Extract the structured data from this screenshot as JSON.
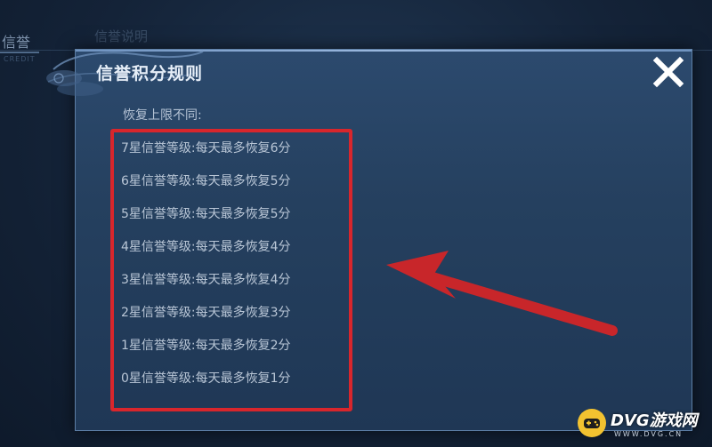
{
  "background": {
    "tab_label": "信誉",
    "tab_sublabel": "CREDIT",
    "tab2_label": "信誉说明"
  },
  "modal": {
    "title": "信誉积分规则",
    "subtitle": "恢复上限不同:",
    "rules": [
      "7星信誉等级:每天最多恢复6分",
      "6星信誉等级:每天最多恢复5分",
      "5星信誉等级:每天最多恢复5分",
      "4星信誉等级:每天最多恢复4分",
      "3星信誉等级:每天最多恢复4分",
      "2星信誉等级:每天最多恢复3分",
      "1星信誉等级:每天最多恢复2分",
      "0星信誉等级:每天最多恢复1分"
    ],
    "close_icon": "close-icon"
  },
  "annotations": {
    "box_color": "#d8262c",
    "arrow_color": "#c8262a"
  },
  "watermark": {
    "brand": "DVG游戏网",
    "domain": "WWW.DVG.CN",
    "accent": "#f2c230"
  }
}
